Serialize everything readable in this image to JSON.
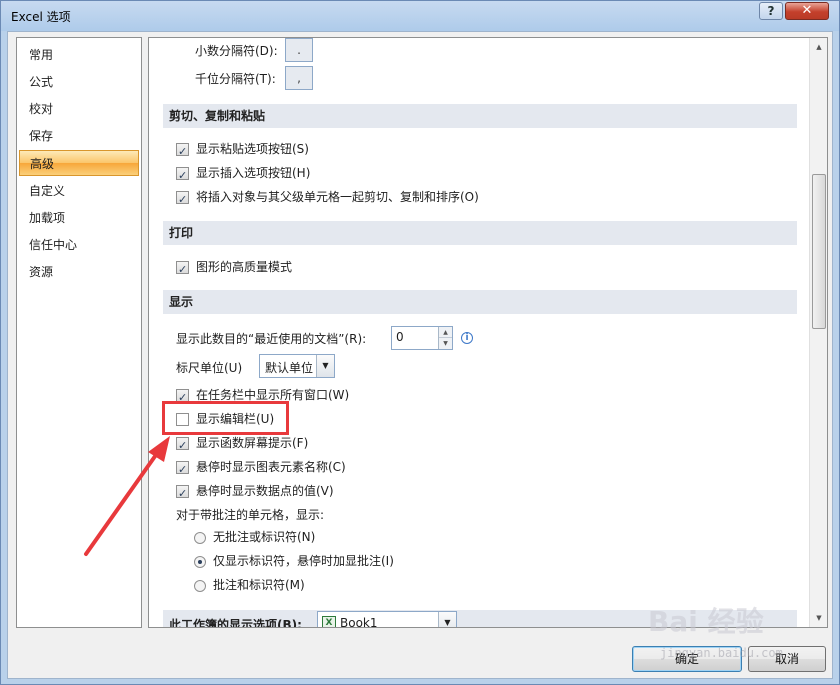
{
  "window": {
    "title": "Excel 选项",
    "help": "?",
    "close": "✕"
  },
  "nav": {
    "items": [
      {
        "label": "常用"
      },
      {
        "label": "公式"
      },
      {
        "label": "校对"
      },
      {
        "label": "保存"
      },
      {
        "label": "高级",
        "active": true
      },
      {
        "label": "自定义"
      },
      {
        "label": "加载项"
      },
      {
        "label": "信任中心"
      },
      {
        "label": "资源"
      }
    ]
  },
  "separators": {
    "decimal_label": "小数分隔符(D):",
    "decimal_value": ".",
    "thousands_label": "千位分隔符(T):",
    "thousands_value": ","
  },
  "cut_copy_paste": {
    "header": "剪切、复制和粘贴",
    "options": [
      {
        "label": "显示粘贴选项按钮(S)",
        "checked": true
      },
      {
        "label": "显示插入选项按钮(H)",
        "checked": true
      },
      {
        "label": "将插入对象与其父级单元格一起剪切、复制和排序(O)",
        "checked": true
      }
    ]
  },
  "print": {
    "header": "打印",
    "options": [
      {
        "label": "图形的高质量模式",
        "checked": true
      }
    ]
  },
  "display": {
    "header": "显示",
    "recent_docs_label": "显示此数目的“最近使用的文档”(R):",
    "recent_docs_value": "0",
    "ruler_label": "标尺单位(U)",
    "ruler_value": "默认单位",
    "options": [
      {
        "label": "在任务栏中显示所有窗口(W)",
        "checked": true
      },
      {
        "label": "显示编辑栏(U)",
        "checked": false
      },
      {
        "label": "显示函数屏幕提示(F)",
        "checked": true
      },
      {
        "label": "悬停时显示图表元素名称(C)",
        "checked": true
      },
      {
        "label": "悬停时显示数据点的值(V)",
        "checked": true
      }
    ],
    "comments_label": "对于带批注的单元格，显示:",
    "comment_options": [
      {
        "label": "无批注或标识符(N)",
        "selected": false
      },
      {
        "label": "仅显示标识符，悬停时加显批注(I)",
        "selected": true
      },
      {
        "label": "批注和标识符(M)",
        "selected": false
      }
    ]
  },
  "workbook": {
    "header": "此工作簿的显示选项(B):",
    "value": "Book1"
  },
  "buttons": {
    "ok": "确定",
    "cancel": "取消"
  },
  "watermark": {
    "text": "Bai 经验",
    "sub": "jingyan.baidu.com"
  }
}
